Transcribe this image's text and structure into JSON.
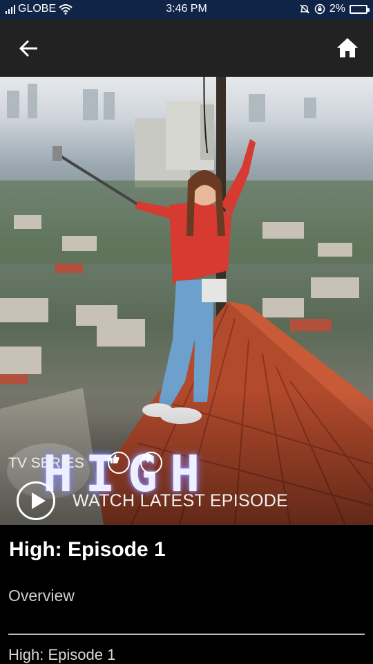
{
  "status_bar": {
    "carrier": "GLOBE",
    "time": "3:46 PM",
    "battery": "2%"
  },
  "header": {
    "back_icon": "back-arrow-icon",
    "home_icon": "home-icon"
  },
  "hero": {
    "show_title_art": "HIGH",
    "category": "TV SERIES",
    "like_icon": "thumbs-up-icon",
    "dislike_icon": "thumbs-down-icon",
    "play_icon": "play-icon",
    "watch_label": "WATCH LATEST EPISODE"
  },
  "content": {
    "episode_title": "High: Episode 1",
    "overview_label": "Overview",
    "episode_subtitle": "High: Episode 1"
  }
}
